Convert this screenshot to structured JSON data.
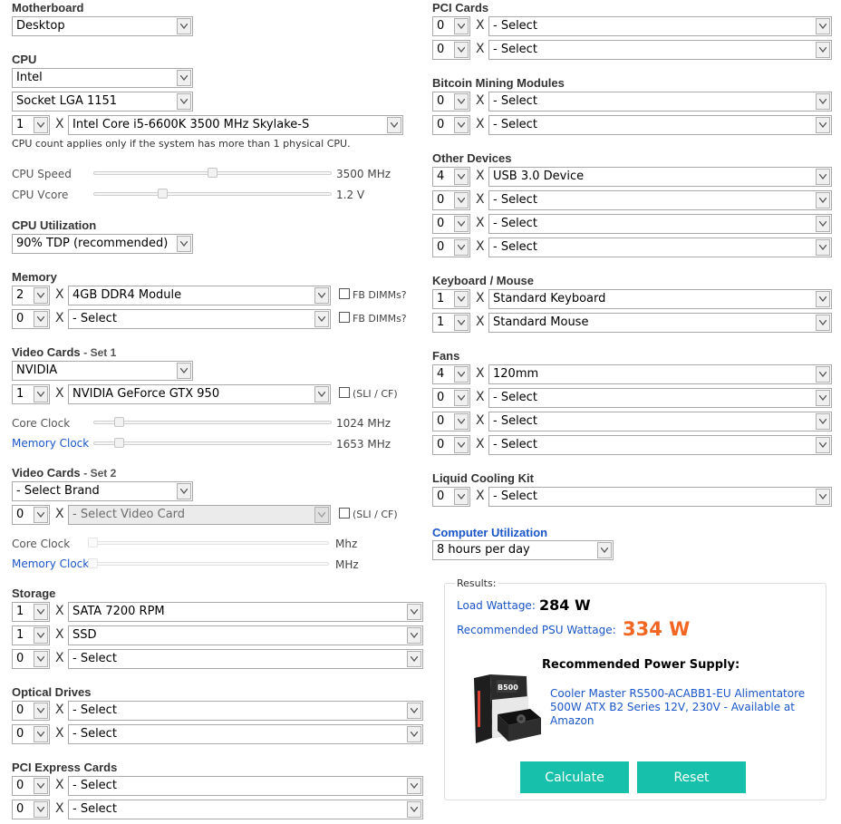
{
  "motherboard": {
    "title": "Motherboard",
    "value": "Desktop"
  },
  "cpu": {
    "title": "CPU",
    "brand": "Intel",
    "socket": "Socket LGA 1151",
    "count": "1",
    "model": "Intel Core i5-6600K 3500 MHz Skylake-S",
    "note": "CPU count applies only if the system has more than 1 physical CPU.",
    "speed_label": "CPU Speed",
    "speed_value": "3500 MHz",
    "vcore_label": "CPU Vcore",
    "vcore_value": "1.2 V"
  },
  "cpu_utilization": {
    "title": "CPU Utilization",
    "value": "90% TDP (recommended)"
  },
  "memory": {
    "title": "Memory",
    "rows": [
      {
        "qty": "2",
        "item": "4GB DDR4 Module",
        "check": "FB DIMMs?"
      },
      {
        "qty": "0",
        "item": "- Select",
        "check": "FB DIMMs?"
      }
    ]
  },
  "video1": {
    "title": "Video Cards",
    "set": "- Set 1",
    "brand": "NVIDIA",
    "qty": "1",
    "card": "NVIDIA GeForce GTX 950",
    "sli": "(SLI / CF)",
    "core_label": "Core Clock",
    "core_value": "1024 MHz",
    "mem_label": "Memory Clock",
    "mem_value": "1653 MHz"
  },
  "video2": {
    "title": "Video Cards",
    "set": "- Set 2",
    "brand": "- Select Brand",
    "qty": "0",
    "card": "- Select Video Card",
    "sli": "(SLI / CF)",
    "core_label": "Core Clock",
    "core_value": "Mhz",
    "mem_label": "Memory Clock",
    "mem_value": "MHz"
  },
  "storage": {
    "title": "Storage",
    "rows": [
      {
        "qty": "1",
        "item": "SATA 7200 RPM"
      },
      {
        "qty": "1",
        "item": "SSD"
      },
      {
        "qty": "0",
        "item": "- Select"
      }
    ]
  },
  "optical": {
    "title": "Optical Drives",
    "rows": [
      {
        "qty": "0",
        "item": "- Select"
      },
      {
        "qty": "0",
        "item": "- Select"
      }
    ]
  },
  "pcie": {
    "title": "PCI Express Cards",
    "rows": [
      {
        "qty": "0",
        "item": "- Select"
      },
      {
        "qty": "0",
        "item": "- Select"
      }
    ]
  },
  "pci": {
    "title": "PCI Cards",
    "rows": [
      {
        "qty": "0",
        "item": "- Select"
      },
      {
        "qty": "0",
        "item": "- Select"
      }
    ]
  },
  "bitcoin": {
    "title": "Bitcoin Mining Modules",
    "rows": [
      {
        "qty": "0",
        "item": "- Select"
      },
      {
        "qty": "0",
        "item": "- Select"
      }
    ]
  },
  "other": {
    "title": "Other Devices",
    "rows": [
      {
        "qty": "4",
        "item": "USB 3.0 Device"
      },
      {
        "qty": "0",
        "item": "- Select"
      },
      {
        "qty": "0",
        "item": "- Select"
      },
      {
        "qty": "0",
        "item": "- Select"
      }
    ]
  },
  "keyboard": {
    "title": "Keyboard / Mouse",
    "rows": [
      {
        "qty": "1",
        "item": "Standard Keyboard"
      },
      {
        "qty": "1",
        "item": "Standard Mouse"
      }
    ]
  },
  "fans": {
    "title": "Fans",
    "rows": [
      {
        "qty": "4",
        "item": "120mm"
      },
      {
        "qty": "0",
        "item": "- Select"
      },
      {
        "qty": "0",
        "item": "- Select"
      },
      {
        "qty": "0",
        "item": "- Select"
      }
    ]
  },
  "liquid": {
    "title": "Liquid Cooling Kit",
    "rows": [
      {
        "qty": "0",
        "item": "- Select"
      }
    ]
  },
  "computer_utilization": {
    "title": "Computer Utilization",
    "value": "8 hours per day"
  },
  "results": {
    "title": "Results:",
    "load_label": "Load Wattage:",
    "load_value": "284 W",
    "psu_label": "Recommended PSU Wattage:",
    "psu_value": "334 W",
    "rec_title": "Recommended Power Supply:",
    "product_link": "Cooler Master RS500-ACABB1-EU Alimentatore 500W ATX B2 Series 12V, 230V - Available at Amazon",
    "product_box_text": "B500"
  },
  "buttons": {
    "calculate": "Calculate",
    "reset": "Reset"
  },
  "multiplier": "X",
  "colors": {
    "accent": "#16c0ab",
    "psu_value": "#f26522",
    "link": "#1a56c8"
  },
  "sliders": {
    "cpu_speed": 0.5,
    "cpu_vcore": 0.28,
    "video1_core": 0.09,
    "video1_mem": 0.09,
    "video2_core": 0,
    "video2_mem": 0
  }
}
